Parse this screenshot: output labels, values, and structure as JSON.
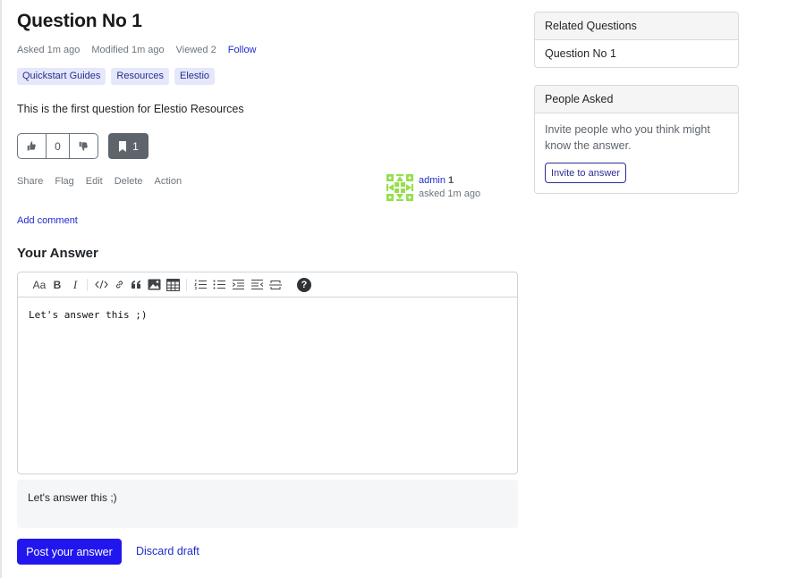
{
  "question": {
    "title": "Question No 1",
    "meta": {
      "asked": "Asked 1m ago",
      "modified": "Modified 1m ago",
      "viewed": "Viewed 2",
      "follow_label": "Follow"
    },
    "tags": [
      "Quickstart Guides",
      "Resources",
      "Elestio"
    ],
    "body": "This is the first question for Elestio Resources",
    "votes": {
      "upvote_icon": "thumbs-up-icon",
      "count": "0",
      "downvote_icon": "thumbs-down-icon"
    },
    "bookmark": {
      "icon": "bookmark-icon",
      "count": "1"
    },
    "actions": [
      "Share",
      "Flag",
      "Edit",
      "Delete",
      "Action"
    ],
    "author": {
      "name": "admin",
      "reputation": "1",
      "asked_time": "asked 1m ago"
    },
    "add_comment_label": "Add comment"
  },
  "answer": {
    "heading": "Your Answer",
    "toolbar": {
      "heading_label": "Aa",
      "bold_label": "B",
      "italic_label": "I",
      "help_label": "?"
    },
    "editor_value": "Let's answer this ;)",
    "preview_text": "Let's answer this ;)",
    "post_label": "Post your answer",
    "discard_label": "Discard draft"
  },
  "sidebar": {
    "related": {
      "title": "Related Questions",
      "items": [
        "Question No 1"
      ]
    },
    "people_asked": {
      "title": "People Asked",
      "description": "Invite people who you think might know the answer.",
      "invite_label": "Invite to answer"
    }
  },
  "colors": {
    "accent": "#2117ee",
    "link": "#1f2ccc",
    "tag_bg": "#e5e7fb",
    "bookmark_bg": "#5d646b"
  }
}
